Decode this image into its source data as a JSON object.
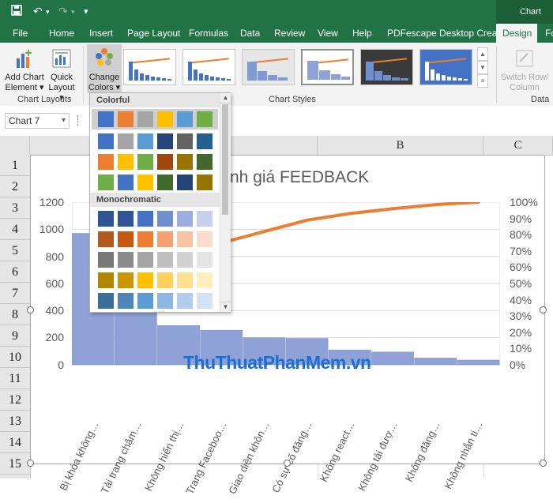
{
  "titlebar": {
    "quick_access": [
      "save-icon",
      "undo-icon",
      "redo-icon",
      "customize-icon"
    ],
    "contextual_label": "Chart Too"
  },
  "tabs": [
    "File",
    "Home",
    "Insert",
    "Page Layout",
    "Formulas",
    "Data",
    "Review",
    "View",
    "Help",
    "PDFescape Desktop Creator",
    "Design",
    "Fo"
  ],
  "active_tab": "Design",
  "ribbon": {
    "add_chart_element": [
      "Add Chart",
      "Element ▾"
    ],
    "quick_layout": [
      "Quick",
      "Layout ▾"
    ],
    "change_colors": [
      "Change",
      "Colors ▾"
    ],
    "group_chart_layouts": "Chart Layouts",
    "group_chart_styles": "Chart Styles",
    "switch_row_column": [
      "Switch Row/",
      "Column"
    ],
    "group_data": "Data"
  },
  "namebox": {
    "value": "Chart 7",
    "dropdown_arrow": "▾"
  },
  "columns": [
    "B",
    "C"
  ],
  "rows": [
    "1",
    "2",
    "3",
    "4",
    "5",
    "6",
    "7",
    "8",
    "9",
    "10",
    "11",
    "12",
    "13",
    "14",
    "15"
  ],
  "dropdown": {
    "section_colorful": "Colorful",
    "section_monochromatic": "Monochromatic",
    "colorful_palettes": [
      [
        "#4472c4",
        "#ed7d31",
        "#a5a5a5",
        "#ffc000",
        "#5b9bd5",
        "#70ad47"
      ],
      [
        "#4472c4",
        "#a5a5a5",
        "#5b9bd5",
        "#264478",
        "#636363",
        "#255e91"
      ],
      [
        "#ed7d31",
        "#ffc000",
        "#70ad47",
        "#9e480e",
        "#997300",
        "#43682b"
      ],
      [
        "#70ad47",
        "#4472c4",
        "#ffc000",
        "#43682b",
        "#264478",
        "#997300"
      ]
    ],
    "mono_palettes": [
      [
        "#2f5597",
        "#305496",
        "#4472c4",
        "#6f8fd1",
        "#9caedf",
        "#c6d0ee"
      ],
      [
        "#b05a1d",
        "#c65911",
        "#ed7d31",
        "#f4a072",
        "#f8c3a2",
        "#fbdcc9"
      ],
      [
        "#787878",
        "#8c8c8c",
        "#a5a5a5",
        "#bfbfbf",
        "#d2d2d2",
        "#e4e4e4"
      ],
      [
        "#b38600",
        "#c99700",
        "#ffc000",
        "#ffd15c",
        "#ffe08f",
        "#ffeebe"
      ],
      [
        "#3b6e99",
        "#4e86b8",
        "#5b9bd5",
        "#8db6e2",
        "#b2cdec",
        "#d3e2f4"
      ]
    ]
  },
  "chart_data": {
    "type": "bar",
    "title": "nh giá FEEDBACK",
    "categories": [
      "Bị khóa không…",
      "Tải trang chậm…",
      "Không hiển thị…",
      "Trang Faceboo…",
      "Giao diện khôn…",
      "Có sự cố đăng…",
      "Không react…",
      "Không tải đượ…",
      "Không đăng…",
      "Không nhắn ti…"
    ],
    "series": [
      {
        "type": "bar",
        "color": "#8ea2d8",
        "values": [
          970,
          540,
          290,
          255,
          200,
          195,
          110,
          95,
          50,
          35
        ]
      },
      {
        "type": "line",
        "color": "#ed7d31",
        "axis": "secondary",
        "values": [
          0.35,
          0.55,
          0.66,
          0.75,
          0.82,
          0.89,
          0.93,
          0.96,
          0.985,
          1.0
        ]
      }
    ],
    "y_ticks": [
      "1200",
      "1000",
      "800",
      "600",
      "400",
      "200",
      "0"
    ],
    "y2_ticks": [
      "100%",
      "90%",
      "80%",
      "70%",
      "60%",
      "50%",
      "40%",
      "30%",
      "20%",
      "10%",
      "0%"
    ],
    "ylim": [
      0,
      1200
    ],
    "y2lim": [
      0,
      1
    ],
    "grid": true
  },
  "watermark": "ThuThuatPhanMem.vn"
}
